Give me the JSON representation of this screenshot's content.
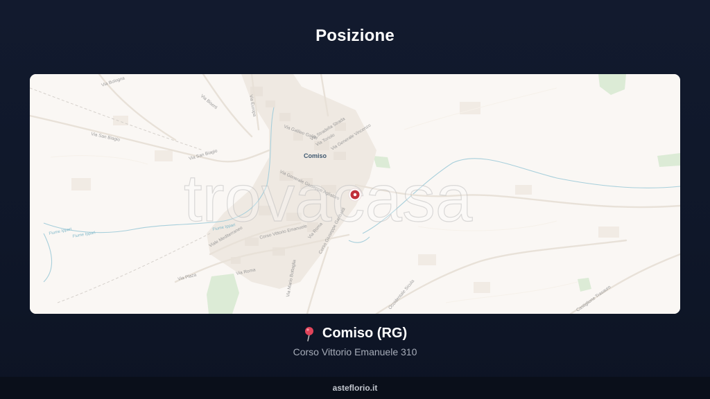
{
  "section": {
    "title": "Posizione"
  },
  "map": {
    "watermark": "trovacasa",
    "town_label": "Comiso",
    "streets": [
      "Via Bologna",
      "Via Biserti",
      "Via Europa",
      "Via San Biagio",
      "Via San Biagio",
      "Via Galileo Galilei",
      "Via Stradella Strada",
      "Via Toriolo",
      "Via Generale Vincenzo",
      "Via Generale Giuseppe Aglialoro",
      "Corso Vittorio Emanuele",
      "Viale Mediterraneo",
      "Via Roma",
      "Corso Giuseppe Garibaldi",
      "Via Roma",
      "Via Plaza",
      "Via Mario Bottaglia",
      "Occidentale Sicula",
      "Castiglione Trasauro"
    ],
    "rivers": [
      "Fiume Ippari",
      "Fiume Ippari",
      "Fiume Ippari"
    ],
    "colors": {
      "marker": "#c0303b",
      "water": "#8fc3d2",
      "park": "#d9ebd5"
    }
  },
  "location": {
    "icon": "map-pin-icon",
    "city": "Comiso (RG)",
    "address": "Corso Vittorio Emanuele 310"
  },
  "footer": {
    "brand": "asteflorio.it"
  }
}
